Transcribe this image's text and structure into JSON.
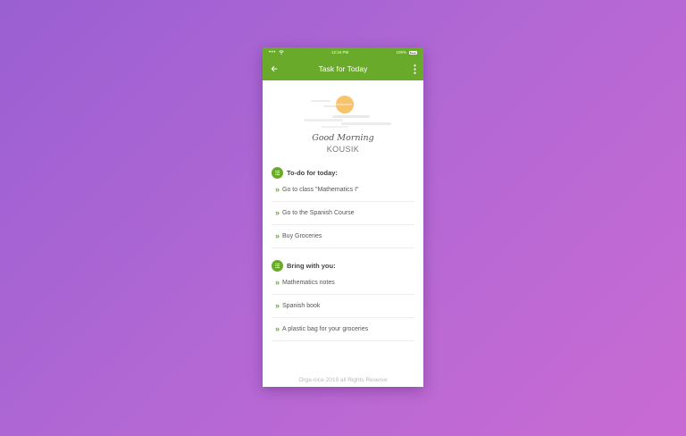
{
  "status_bar": {
    "time": "12:34 PM",
    "battery": "100%"
  },
  "app_bar": {
    "title": "Task for Today",
    "back_icon": "arrow-left-icon",
    "more_icon": "more-vert-icon"
  },
  "greeting": {
    "line": "Good Morning",
    "user": "KOUSIK"
  },
  "todo": {
    "title": "To-do for today:",
    "items": [
      {
        "label": "Go to class \"Mathematics I\""
      },
      {
        "label": "Go to the Spanish Course"
      },
      {
        "label": "Buy Groceries"
      }
    ]
  },
  "bring": {
    "title": "Bring with you:",
    "items": [
      {
        "label": "Mathematics notes"
      },
      {
        "label": "Spanish book"
      },
      {
        "label": "A plastic bag for your groceries"
      }
    ]
  },
  "footer": {
    "text": "Orga-nice 2019 all Rights Reserve"
  },
  "colors": {
    "accent": "#6aaa2b",
    "sun": "#f8c36a"
  }
}
